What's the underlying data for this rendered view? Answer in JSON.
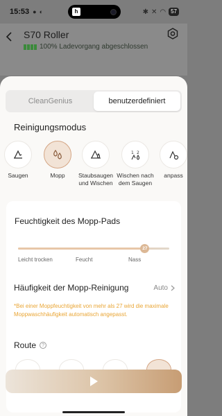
{
  "status_bar": {
    "time": "15:53",
    "left_icons": [
      "M",
      "G",
      "G"
    ],
    "battery": "57"
  },
  "header": {
    "title": "S70 Roller",
    "status": "100%  Ladevorgang abgeschlossen"
  },
  "tabs": [
    {
      "label": "CleanGenius",
      "active": false
    },
    {
      "label": "benutzerdefiniert",
      "active": true
    }
  ],
  "modes_section": {
    "title": "Reinigungsmodus",
    "items": [
      {
        "label": "Saugen",
        "icon": "vacuum-icon"
      },
      {
        "label": "Mopp",
        "icon": "mop-drops-icon",
        "selected": true
      },
      {
        "label": "Staubsaugen und Wischen",
        "icon": "vacuum-mop-icon"
      },
      {
        "label": "Wischen nach dem Saugen",
        "icon": "mop-after-vacuum-icon"
      },
      {
        "label": "anpass",
        "icon": "custom-icon"
      }
    ]
  },
  "moisture": {
    "title": "Feuchtigkeit des Mopp-Pads",
    "value": 27,
    "value_label": "27",
    "labels": [
      "Leicht trocken",
      "Feucht",
      "Nass"
    ]
  },
  "frequency": {
    "title": "Häufigkeit der Mopp-Reinigung",
    "value": "Auto"
  },
  "hint": "*Bei einer Moppfeuchtigkeit von mehr als 27 wird die maximale Moppwaschhäufigkeit automatisch angepasst.",
  "route": {
    "title": "Route"
  },
  "colors": {
    "accent": "#d4a584",
    "hint": "#e9a534",
    "sheet": "#faf9f7"
  }
}
